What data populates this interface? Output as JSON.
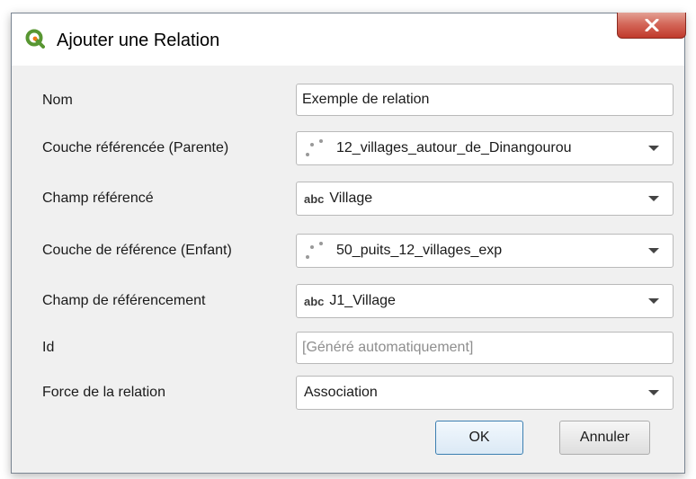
{
  "window": {
    "title": "Ajouter une Relation",
    "app_icon": "qgis-icon",
    "close_icon": "close-icon"
  },
  "form": {
    "name": {
      "label": "Nom",
      "value": "Exemple de relation"
    },
    "referenced_layer": {
      "label": "Couche référencée (Parente)",
      "value": "12_villages_autour_de_Dinangourou",
      "icon": "point-layer-icon"
    },
    "referenced_field": {
      "label": "Champ référencé",
      "type_tag": "abc",
      "value": "Village"
    },
    "referencing_layer": {
      "label": "Couche de référence (Enfant)",
      "value": "50_puits_12_villages_exp",
      "icon": "point-layer-icon"
    },
    "referencing_field": {
      "label": "Champ de référencement",
      "type_tag": "abc",
      "value": "J1_Village"
    },
    "id": {
      "label": "Id",
      "placeholder": "[Généré automatiquement]",
      "value": ""
    },
    "strength": {
      "label": "Force de la relation",
      "value": "Association"
    }
  },
  "buttons": {
    "ok": "OK",
    "cancel": "Annuler"
  },
  "colors": {
    "qgis_green": "#589632",
    "qgis_yellow": "#ee7913",
    "close_red": "#c0392b"
  }
}
